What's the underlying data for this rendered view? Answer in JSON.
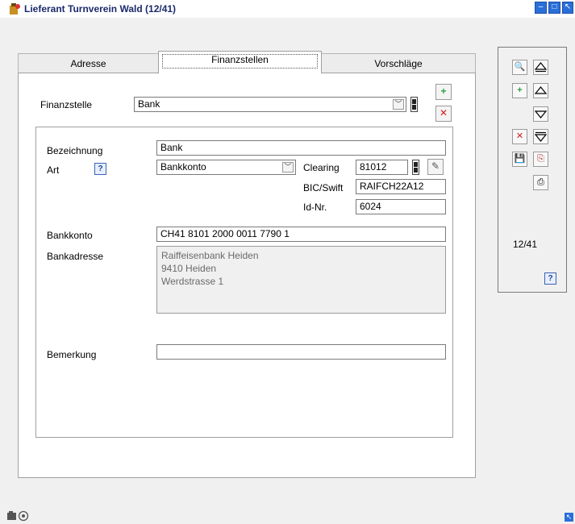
{
  "window": {
    "title": "Lieferant Turnverein Wald (12/41)",
    "minimize_glyph": "–",
    "maximize_glyph": "□",
    "close_glyph": "↖"
  },
  "tabs": [
    {
      "label": "Adresse",
      "active": false
    },
    {
      "label": "Finanzstellen",
      "active": true
    },
    {
      "label": "Vorschläge",
      "active": false
    }
  ],
  "finanzstelle": {
    "label": "Finanzstelle",
    "value": "Bank",
    "add_glyph": "+",
    "delete_glyph": "✕"
  },
  "form": {
    "bezeichnung_label": "Bezeichnung",
    "bezeichnung_value": "Bank",
    "art_label": "Art",
    "help_glyph": "?",
    "art_value": "Bankkonto",
    "clearing_label": "Clearing",
    "clearing_value": "81012",
    "edit_glyph": "✎",
    "bic_label": "BIC/Swift",
    "bic_value": "RAIFCH22A12",
    "idnr_label": "Id-Nr.",
    "idnr_value": "6024",
    "bankkonto_label": "Bankkonto",
    "bankkonto_value": "CH41 8101 2000 0011 7790 1",
    "bankadresse_label": "Bankadresse",
    "bankadresse_lines": [
      "Raiffeisenbank Heiden",
      "9410 Heiden",
      "Werdstrasse 1"
    ],
    "bemerkung_label": "Bemerkung",
    "bemerkung_value": ""
  },
  "nav": {
    "record_counter": "12/41",
    "help_glyph": "?",
    "search_glyph": "🔍",
    "add_glyph": "+",
    "delete_glyph": "✕",
    "save_glyph": "💾",
    "copy_glyph": "⎘",
    "print_glyph": "⎙"
  },
  "colors": {
    "titlebar_text": "#1a2a6c",
    "accent_blue": "#2a6fd8",
    "add_green": "#2e9e3a",
    "delete_red": "#d02020"
  }
}
